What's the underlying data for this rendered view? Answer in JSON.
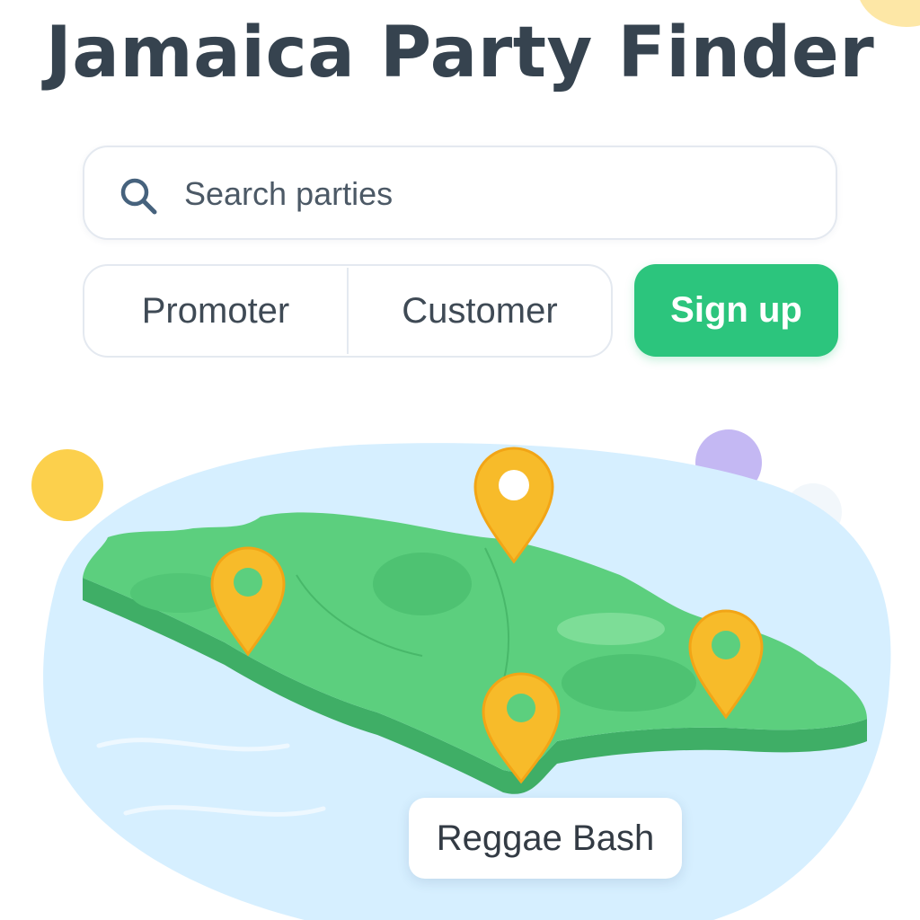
{
  "app": {
    "title": "Jamaica Party Finder"
  },
  "search": {
    "placeholder": "Search parties",
    "value": ""
  },
  "role_toggle": {
    "options": [
      "Promoter",
      "Customer"
    ]
  },
  "actions": {
    "signup_label": "Sign up"
  },
  "map": {
    "pins": [
      {
        "name": "pin-west"
      },
      {
        "name": "pin-north"
      },
      {
        "name": "pin-south"
      },
      {
        "name": "pin-east"
      }
    ],
    "selected_event_label": "Reggae Bash"
  },
  "colors": {
    "accent": "#2cc57d",
    "title": "#36434f",
    "land": "#5ccf7e",
    "water": "#d6efff",
    "pin": "#f7bb2a"
  },
  "icons": [
    "search-icon",
    "map-pin-icon"
  ]
}
